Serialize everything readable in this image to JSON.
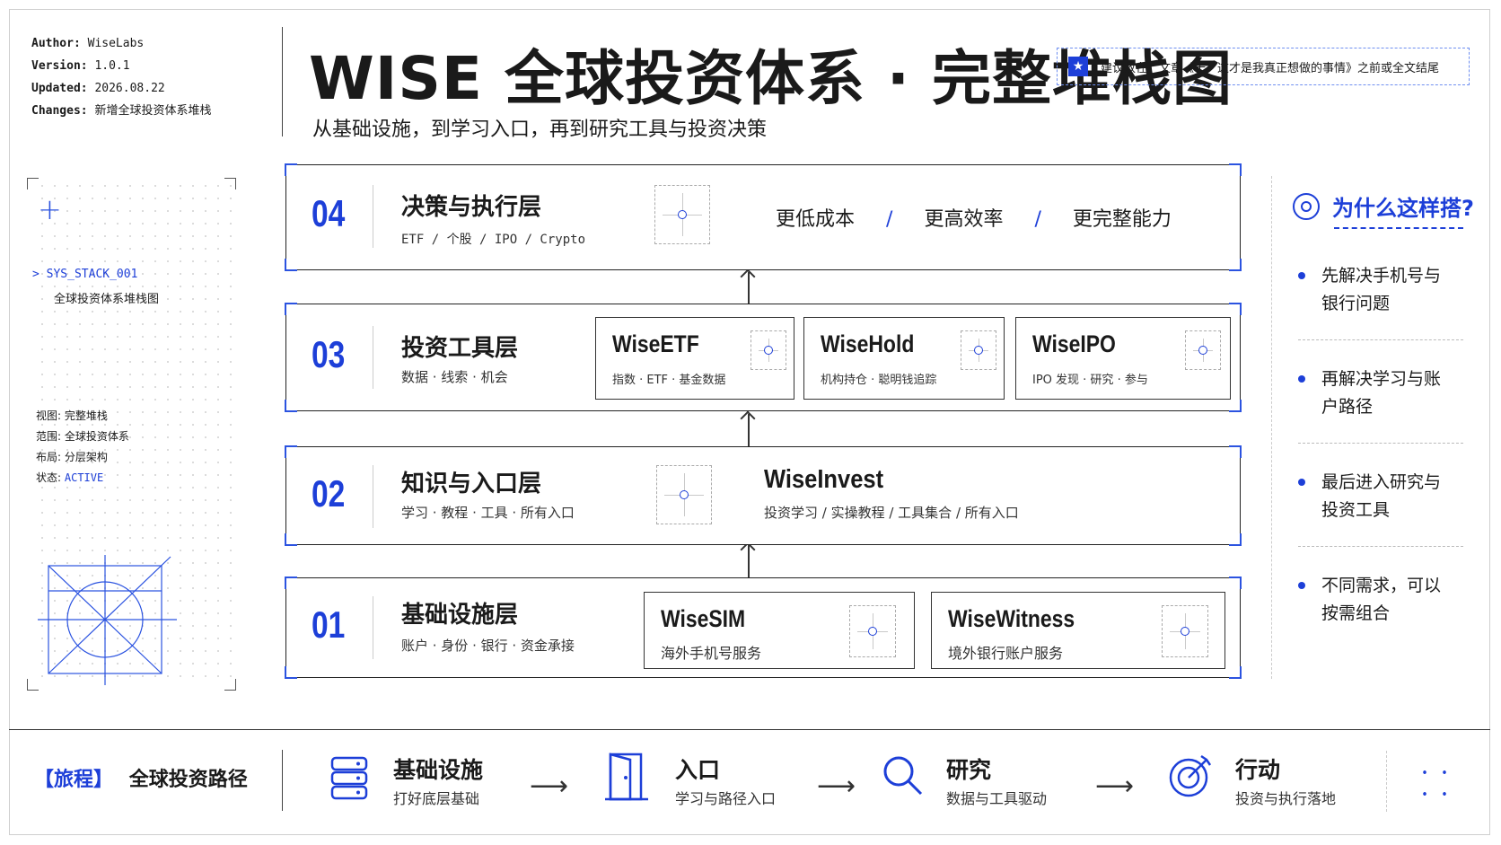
{
  "meta": {
    "author_k": "Author:",
    "author_v": "WiseLabs",
    "version_k": "Version:",
    "version_v": "1.0.1",
    "updated_k": "Updated:",
    "updated_v": "2026.08.22",
    "changes_k": "Changes:",
    "changes_v": "新增全球投资体系堆栈"
  },
  "title": "WISE 全球投资体系 · 完整堆栈图",
  "subtitle": "从基础设施，到学习入口，再到研究工具与投资决策",
  "note": "建议放在：文章《十、这才是我真正想做的事情》之前或全文结尾",
  "sys": {
    "id": "> SYS_STACK_001",
    "name": "全球投资体系堆栈图"
  },
  "kv": [
    {
      "k": "视图:",
      "v": "完整堆栈"
    },
    {
      "k": "范围:",
      "v": "全球投资体系"
    },
    {
      "k": "布局:",
      "v": "分层架构"
    },
    {
      "k": "状态:",
      "v": "ACTIVE"
    }
  ],
  "layers": {
    "l4": {
      "num": "04",
      "name": "决策与执行层",
      "desc": "ETF / 个股 / IPO / Crypto",
      "benefits": [
        "更低成本",
        "/",
        "更高效率",
        "/",
        "更完整能力"
      ]
    },
    "l3": {
      "num": "03",
      "name": "投资工具层",
      "desc": "数据 · 线索 · 机会",
      "cards": [
        {
          "name": "WiseETF",
          "desc": "指数 · ETF · 基金数据"
        },
        {
          "name": "WiseHold",
          "desc": "机构持仓 · 聪明钱追踪"
        },
        {
          "name": "WiseIPO",
          "desc": "IPO 发现 · 研究 · 参与"
        }
      ]
    },
    "l2": {
      "num": "02",
      "name": "知识与入口层",
      "desc": "学习 · 教程 · 工具 · 所有入口",
      "product": "WiseInvest",
      "product_desc": "投资学习 / 实操教程 / 工具集合 / 所有入口"
    },
    "l1": {
      "num": "01",
      "name": "基础设施层",
      "desc": "账户 · 身份 · 银行 · 资金承接",
      "cards": [
        {
          "name": "WiseSIM",
          "desc": "海外手机号服务"
        },
        {
          "name": "WiseWitness",
          "desc": "境外银行账户服务"
        }
      ]
    }
  },
  "why": {
    "title": "为什么这样搭?",
    "items": [
      "先解决手机号与银行问题",
      "再解决学习与账户路径",
      "最后进入研究与投资工具",
      "不同需求，可以按需组合"
    ]
  },
  "journey": {
    "bracket": "【旅程】",
    "label": "全球投资路径",
    "steps": [
      {
        "name": "基础设施",
        "desc": "打好底层基础",
        "icon": "server-icon"
      },
      {
        "name": "入口",
        "desc": "学习与路径入口",
        "icon": "door-icon"
      },
      {
        "name": "研究",
        "desc": "数据与工具驱动",
        "icon": "magnifier-icon"
      },
      {
        "name": "行动",
        "desc": "投资与执行落地",
        "icon": "target-icon"
      }
    ],
    "arrow": "⟶"
  },
  "colors": {
    "accent": "#1d3fd8",
    "ink": "#1a1a1a"
  }
}
